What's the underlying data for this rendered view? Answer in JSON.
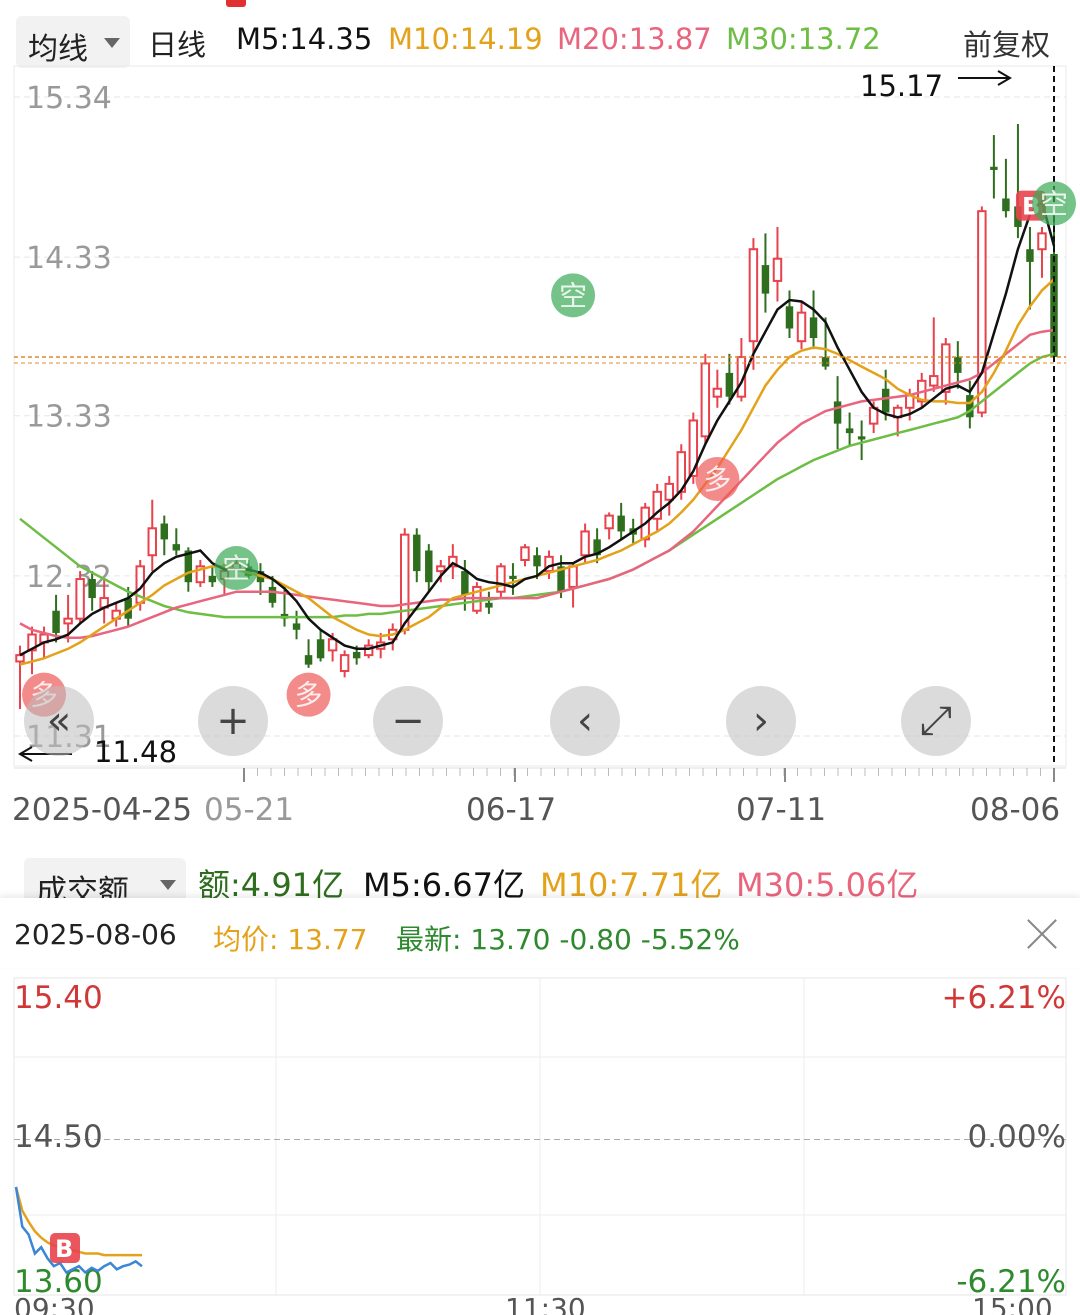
{
  "header": {
    "period_selector": "均线",
    "period": "日线",
    "ma5": "M5:14.35",
    "ma10": "M10:14.19",
    "ma20": "M20:13.87",
    "ma30": "M30:13.72",
    "adjust": "前复权"
  },
  "colors": {
    "up": "#e8424c",
    "down": "#2f6e1e",
    "ma5": "#111111",
    "ma10": "#e3a21a",
    "ma20": "#e9657d",
    "ma30": "#6ebd45",
    "grid": "#e6e6e6",
    "price_line": "#e08a2b"
  },
  "chart_data": [
    {
      "type": "candlestick",
      "title": "日线",
      "y_ticks": [
        "15.34",
        "14.33",
        "13.33",
        "12.32",
        "11.31"
      ],
      "ylim": [
        11.31,
        15.34
      ],
      "x_ticks": [
        "2025-04-25",
        "05-21",
        "06-17",
        "07-11",
        "08-06"
      ],
      "high_marker": "15.17",
      "low_marker": "11.48",
      "current_price_line": 13.7,
      "candles": [
        [
          11.78,
          11.88,
          11.48,
          11.82
        ],
        [
          11.85,
          12.0,
          11.7,
          11.95
        ],
        [
          11.9,
          12.0,
          11.8,
          11.95
        ],
        [
          12.1,
          12.2,
          11.9,
          11.96
        ],
        [
          12.02,
          12.2,
          11.9,
          12.05
        ],
        [
          12.05,
          12.35,
          12.02,
          12.3
        ],
        [
          12.3,
          12.35,
          12.1,
          12.18
        ],
        [
          12.12,
          12.3,
          12.02,
          12.18
        ],
        [
          12.05,
          12.15,
          12.0,
          12.1
        ],
        [
          12.18,
          12.25,
          12.0,
          12.05
        ],
        [
          12.15,
          12.42,
          12.1,
          12.38
        ],
        [
          12.45,
          12.8,
          12.35,
          12.62
        ],
        [
          12.65,
          12.7,
          12.45,
          12.55
        ],
        [
          12.52,
          12.62,
          12.45,
          12.48
        ],
        [
          12.48,
          12.5,
          12.22,
          12.28
        ],
        [
          12.28,
          12.42,
          12.25,
          12.38
        ],
        [
          12.32,
          12.38,
          12.25,
          12.28
        ],
        [
          12.3,
          12.4,
          12.2,
          12.35
        ],
        [
          12.36,
          12.45,
          12.3,
          12.4
        ],
        [
          12.38,
          12.42,
          12.3,
          12.32
        ],
        [
          12.35,
          12.4,
          12.2,
          12.28
        ],
        [
          12.25,
          12.32,
          12.12,
          12.15
        ],
        [
          12.08,
          12.25,
          12.0,
          12.05
        ],
        [
          12.02,
          12.1,
          11.92,
          11.98
        ],
        [
          11.82,
          11.92,
          11.74,
          11.76
        ],
        [
          11.92,
          11.98,
          11.78,
          11.8
        ],
        [
          11.85,
          11.96,
          11.78,
          11.92
        ],
        [
          11.72,
          11.85,
          11.68,
          11.82
        ],
        [
          11.84,
          11.88,
          11.76,
          11.8
        ],
        [
          11.82,
          11.92,
          11.8,
          11.88
        ],
        [
          11.86,
          11.96,
          11.8,
          11.9
        ],
        [
          11.92,
          12.02,
          11.85,
          11.98
        ],
        [
          11.98,
          12.62,
          11.95,
          12.58
        ],
        [
          12.58,
          12.62,
          12.28,
          12.35
        ],
        [
          12.48,
          12.52,
          12.22,
          12.28
        ],
        [
          12.35,
          12.42,
          12.28,
          12.38
        ],
        [
          12.38,
          12.52,
          12.3,
          12.44
        ],
        [
          12.35,
          12.42,
          12.1,
          12.2
        ],
        [
          12.1,
          12.28,
          12.08,
          12.25
        ],
        [
          12.15,
          12.22,
          12.08,
          12.12
        ],
        [
          12.22,
          12.4,
          12.18,
          12.38
        ],
        [
          12.32,
          12.4,
          12.2,
          12.3
        ],
        [
          12.42,
          12.52,
          12.38,
          12.5
        ],
        [
          12.45,
          12.5,
          12.3,
          12.38
        ],
        [
          12.35,
          12.48,
          12.3,
          12.44
        ],
        [
          12.38,
          12.45,
          12.18,
          12.22
        ],
        [
          12.25,
          12.4,
          12.12,
          12.38
        ],
        [
          12.45,
          12.65,
          12.4,
          12.6
        ],
        [
          12.55,
          12.62,
          12.4,
          12.45
        ],
        [
          12.62,
          12.72,
          12.55,
          12.7
        ],
        [
          12.7,
          12.78,
          12.55,
          12.6
        ],
        [
          12.62,
          12.68,
          12.52,
          12.58
        ],
        [
          12.55,
          12.78,
          12.5,
          12.75
        ],
        [
          12.68,
          12.9,
          12.6,
          12.85
        ],
        [
          12.8,
          12.95,
          12.7,
          12.9
        ],
        [
          12.85,
          13.15,
          12.8,
          13.1
        ],
        [
          12.95,
          13.35,
          12.9,
          13.3
        ],
        [
          13.2,
          13.72,
          13.15,
          13.66
        ],
        [
          13.45,
          13.62,
          13.38,
          13.5
        ],
        [
          13.6,
          13.72,
          13.4,
          13.45
        ],
        [
          13.45,
          13.82,
          13.42,
          13.7
        ],
        [
          13.8,
          14.45,
          13.62,
          14.38
        ],
        [
          14.28,
          14.48,
          13.98,
          14.1
        ],
        [
          14.18,
          14.52,
          14.05,
          14.32
        ],
        [
          14.02,
          14.12,
          13.82,
          13.88
        ],
        [
          13.8,
          14.05,
          13.75,
          13.98
        ],
        [
          13.95,
          14.12,
          13.75,
          13.82
        ],
        [
          13.7,
          13.95,
          13.62,
          13.64
        ],
        [
          13.42,
          13.58,
          13.12,
          13.28
        ],
        [
          13.25,
          13.35,
          13.14,
          13.22
        ],
        [
          13.2,
          13.3,
          13.05,
          13.18
        ],
        [
          13.28,
          13.42,
          13.22,
          13.38
        ],
        [
          13.5,
          13.62,
          13.3,
          13.35
        ],
        [
          13.32,
          13.4,
          13.2,
          13.38
        ],
        [
          13.38,
          13.5,
          13.3,
          13.46
        ],
        [
          13.42,
          13.6,
          13.38,
          13.55
        ],
        [
          13.52,
          13.95,
          13.48,
          13.58
        ],
        [
          13.48,
          13.82,
          13.4,
          13.78
        ],
        [
          13.7,
          13.8,
          13.5,
          13.6
        ],
        [
          13.46,
          13.55,
          13.25,
          13.32
        ],
        [
          13.35,
          14.65,
          13.32,
          14.62
        ],
        [
          14.9,
          15.1,
          14.7,
          14.88
        ],
        [
          14.7,
          14.95,
          14.58,
          14.62
        ],
        [
          14.65,
          15.17,
          14.45,
          14.52
        ],
        [
          14.38,
          14.52,
          14.0,
          14.3
        ],
        [
          14.38,
          14.52,
          14.2,
          14.48
        ],
        [
          14.35,
          14.6,
          13.7,
          13.7
        ]
      ],
      "ma5_line": [
        11.82,
        11.86,
        11.9,
        11.92,
        11.95,
        12.02,
        12.08,
        12.12,
        12.15,
        12.18,
        12.24,
        12.34,
        12.4,
        12.44,
        12.46,
        12.48,
        12.4,
        12.36,
        12.36,
        12.36,
        12.34,
        12.3,
        12.24,
        12.16,
        12.05,
        11.98,
        11.93,
        11.88,
        11.86,
        11.86,
        11.88,
        11.9,
        12.02,
        12.12,
        12.22,
        12.32,
        12.4,
        12.36,
        12.3,
        12.28,
        12.27,
        12.25,
        12.3,
        12.32,
        12.38,
        12.4,
        12.4,
        12.44,
        12.46,
        12.5,
        12.55,
        12.6,
        12.65,
        12.72,
        12.78,
        12.86,
        12.98,
        13.15,
        13.3,
        13.42,
        13.54,
        13.72,
        13.86,
        14.0,
        14.06,
        14.05,
        14.0,
        13.92,
        13.76,
        13.62,
        13.48,
        13.38,
        13.34,
        13.32,
        13.34,
        13.38,
        13.44,
        13.5,
        13.52,
        13.48,
        13.6,
        13.85,
        14.1,
        14.38,
        14.6,
        14.68,
        14.4
      ],
      "ma10_line": [
        11.76,
        11.78,
        11.8,
        11.83,
        11.86,
        11.9,
        11.95,
        12.0,
        12.05,
        12.1,
        12.15,
        12.2,
        12.26,
        12.3,
        12.34,
        12.36,
        12.38,
        12.38,
        12.36,
        12.34,
        12.32,
        12.3,
        12.26,
        12.22,
        12.18,
        12.12,
        12.06,
        12.02,
        11.98,
        11.95,
        11.94,
        11.95,
        11.98,
        12.02,
        12.06,
        12.12,
        12.18,
        12.2,
        12.22,
        12.24,
        12.26,
        12.28,
        12.3,
        12.32,
        12.34,
        12.36,
        12.38,
        12.4,
        12.42,
        12.45,
        12.48,
        12.52,
        12.56,
        12.6,
        12.65,
        12.72,
        12.8,
        12.9,
        13.0,
        13.12,
        13.24,
        13.38,
        13.52,
        13.62,
        13.7,
        13.74,
        13.76,
        13.75,
        13.72,
        13.68,
        13.64,
        13.6,
        13.56,
        13.5,
        13.46,
        13.43,
        13.42,
        13.42,
        13.41,
        13.41,
        13.48,
        13.6,
        13.74,
        13.9,
        14.02,
        14.12,
        14.19
      ],
      "ma20_line": [
        12.02,
        11.98,
        11.96,
        11.94,
        11.93,
        11.93,
        11.94,
        11.96,
        11.98,
        12.0,
        12.03,
        12.06,
        12.09,
        12.12,
        12.14,
        12.16,
        12.18,
        12.2,
        12.22,
        12.22,
        12.22,
        12.22,
        12.21,
        12.2,
        12.19,
        12.18,
        12.17,
        12.16,
        12.15,
        12.14,
        12.13,
        12.13,
        12.14,
        12.15,
        12.16,
        12.17,
        12.17,
        12.18,
        12.18,
        12.18,
        12.18,
        12.18,
        12.18,
        12.18,
        12.2,
        12.22,
        12.24,
        12.26,
        12.28,
        12.3,
        12.33,
        12.36,
        12.4,
        12.44,
        12.48,
        12.54,
        12.6,
        12.68,
        12.76,
        12.84,
        12.92,
        13.0,
        13.08,
        13.16,
        13.22,
        13.28,
        13.32,
        13.36,
        13.38,
        13.4,
        13.42,
        13.43,
        13.44,
        13.45,
        13.46,
        13.48,
        13.5,
        13.52,
        13.54,
        13.56,
        13.6,
        13.66,
        13.72,
        13.78,
        13.84,
        13.86,
        13.87
      ],
      "ma30_line": [
        12.68,
        12.62,
        12.56,
        12.5,
        12.44,
        12.38,
        12.34,
        12.3,
        12.26,
        12.22,
        12.19,
        12.16,
        12.13,
        12.11,
        12.09,
        12.08,
        12.07,
        12.06,
        12.06,
        12.06,
        12.06,
        12.06,
        12.06,
        12.06,
        12.06,
        12.06,
        12.06,
        12.07,
        12.07,
        12.08,
        12.08,
        12.09,
        12.1,
        12.11,
        12.12,
        12.13,
        12.14,
        12.15,
        12.16,
        12.17,
        12.18,
        12.18,
        12.19,
        12.2,
        12.21,
        12.22,
        12.24,
        12.26,
        12.28,
        12.3,
        12.33,
        12.36,
        12.4,
        12.44,
        12.48,
        12.53,
        12.58,
        12.63,
        12.68,
        12.73,
        12.78,
        12.83,
        12.88,
        12.93,
        12.97,
        13.01,
        13.05,
        13.08,
        13.11,
        13.14,
        13.16,
        13.18,
        13.2,
        13.22,
        13.24,
        13.26,
        13.28,
        13.3,
        13.32,
        13.36,
        13.42,
        13.48,
        13.54,
        13.6,
        13.66,
        13.7,
        13.72
      ],
      "markers": [
        {
          "label": "多",
          "index": 2,
          "price": 11.76,
          "type": "buy"
        },
        {
          "label": "空",
          "index": 18,
          "price": 12.18,
          "type": "sell"
        },
        {
          "label": "多",
          "index": 24,
          "price": 11.76,
          "type": "buy"
        },
        {
          "label": "空",
          "index": 46,
          "price": 13.9,
          "type": "sell"
        },
        {
          "label": "多",
          "index": 58,
          "price": 13.12,
          "type": "buy"
        },
        {
          "label": "B",
          "index": 84,
          "price": 14.56,
          "type": "buy-flag"
        },
        {
          "label": "空",
          "index": 86,
          "price": 14.48,
          "type": "sell"
        }
      ]
    },
    {
      "type": "line",
      "title": "分时",
      "date": "2025-08-06",
      "avg_label": "均价: 13.77",
      "latest_label": "最新: 13.70 -0.80 -5.52%",
      "y_ticks_left": [
        "15.40",
        "14.50",
        "13.60"
      ],
      "y_ticks_right": [
        "+6.21%",
        "0.00%",
        "-6.21%"
      ],
      "x_ticks": [
        "09:30",
        "11:30",
        "15:00"
      ],
      "ylim": [
        13.6,
        15.4
      ],
      "prev_close": 14.5,
      "price_series": [
        14.2,
        13.95,
        13.9,
        13.78,
        13.82,
        13.75,
        13.7,
        13.72,
        13.66,
        13.68,
        13.7,
        13.66,
        13.69,
        13.67,
        13.7,
        13.72,
        13.68,
        13.7,
        13.71,
        13.73,
        13.7
      ],
      "avg_series": [
        14.2,
        14.05,
        13.98,
        13.92,
        13.88,
        13.85,
        13.83,
        13.82,
        13.8,
        13.8,
        13.79,
        13.78,
        13.78,
        13.78,
        13.77,
        13.77,
        13.77,
        13.77,
        13.77,
        13.77,
        13.77
      ],
      "marker": "B"
    }
  ],
  "volume": {
    "selector": "成交额",
    "amount": "额:4.91亿",
    "m5": "M5:6.67亿",
    "m10": "M10:7.71亿",
    "m30": "M30:5.06亿"
  },
  "nav_buttons": [
    "«",
    "+",
    "−",
    "‹",
    "›",
    "⤢"
  ]
}
